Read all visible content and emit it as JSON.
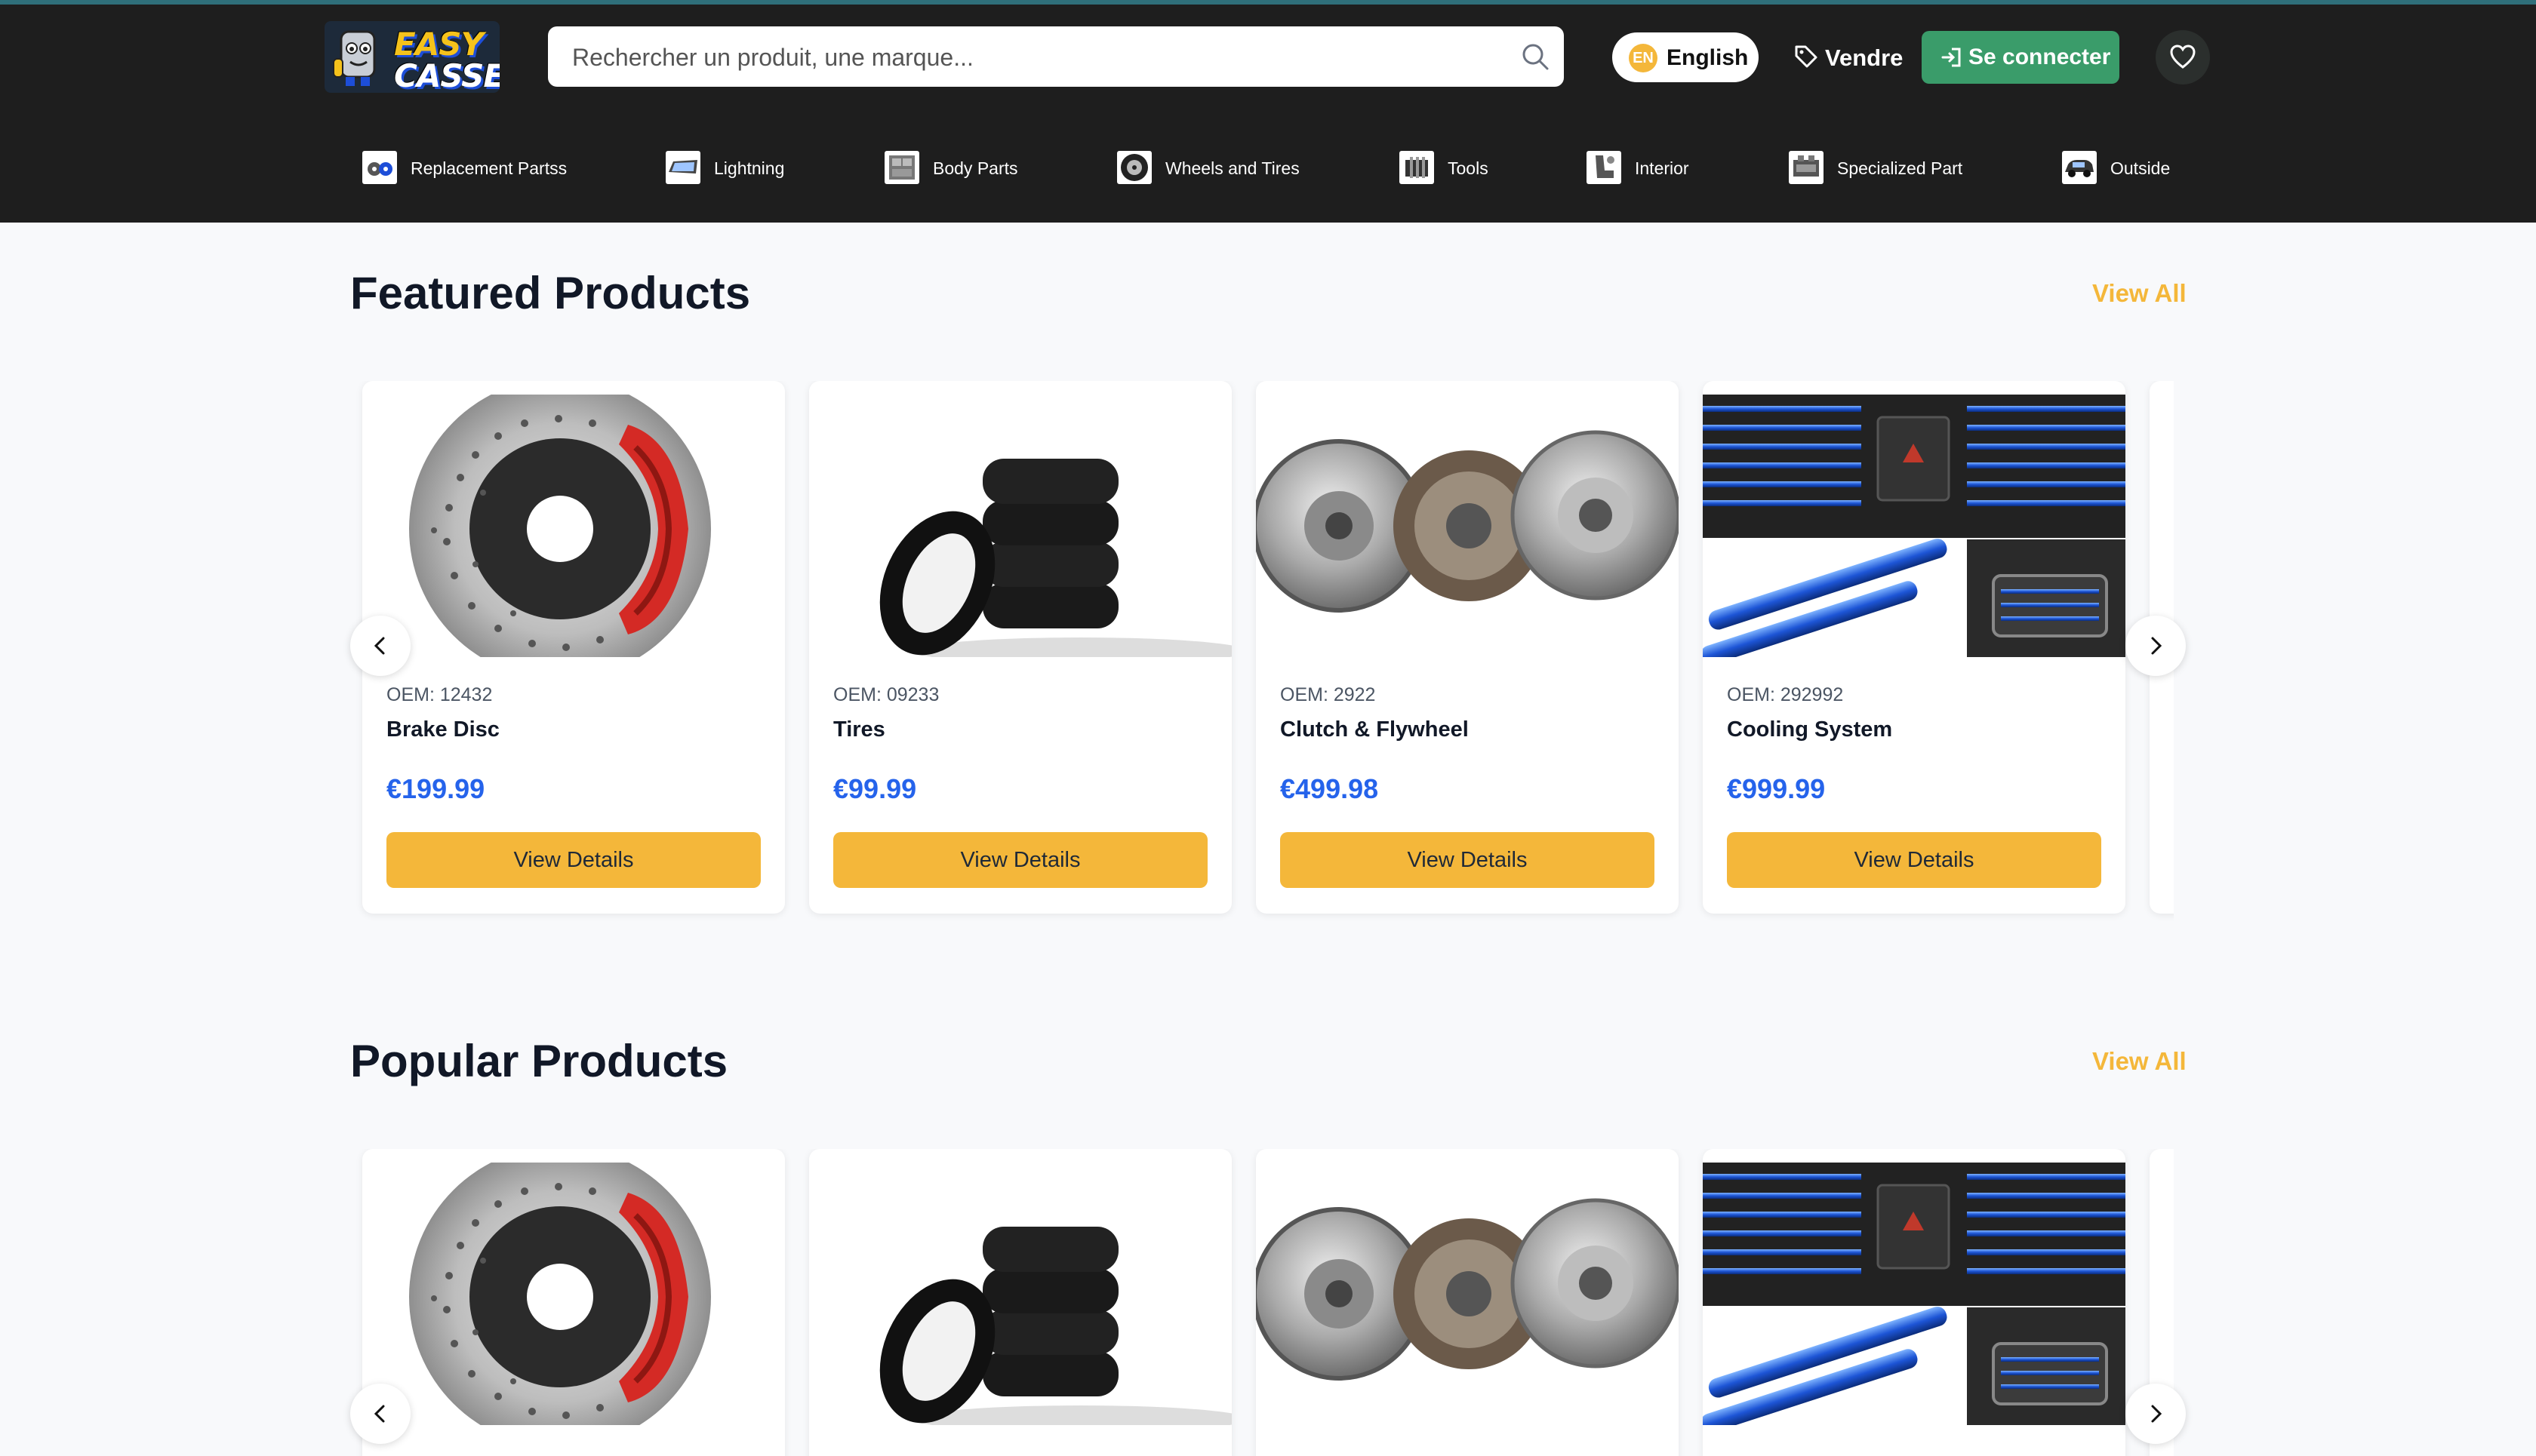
{
  "brand": {
    "logo_line1": "EASY",
    "logo_line2": "CASSE"
  },
  "search": {
    "placeholder": "Rechercher un produit, une marque..."
  },
  "header": {
    "language_code": "EN",
    "language_label": "English",
    "sell_label": "Vendre",
    "login_label": "Se connecter"
  },
  "categories": [
    {
      "label": "Replacement Partss",
      "icon": "brake-parts-icon"
    },
    {
      "label": "Lightning",
      "icon": "headlight-icon"
    },
    {
      "label": "Body Parts",
      "icon": "car-body-icon"
    },
    {
      "label": "Wheels and Tires",
      "icon": "wheel-icon"
    },
    {
      "label": "Tools",
      "icon": "tools-icon"
    },
    {
      "label": "Interior",
      "icon": "seat-icon"
    },
    {
      "label": "Specialized Part",
      "icon": "engine-icon"
    },
    {
      "label": "Outside",
      "icon": "car-exterior-icon"
    }
  ],
  "featured": {
    "title": "Featured Products",
    "view_all": "View All",
    "products": [
      {
        "oem": "OEM: 12432",
        "name": "Brake Disc",
        "price": "€199.99",
        "button": "View Details",
        "image": "brake-disc"
      },
      {
        "oem": "OEM: 09233",
        "name": "Tires",
        "price": "€99.99",
        "button": "View Details",
        "image": "tires"
      },
      {
        "oem": "OEM: 2922",
        "name": "Clutch & Flywheel",
        "price": "€499.98",
        "button": "View Details",
        "image": "clutch-flywheel"
      },
      {
        "oem": "OEM: 292992",
        "name": "Cooling System",
        "price": "€999.99",
        "button": "View Details",
        "image": "cooling-system"
      }
    ]
  },
  "popular": {
    "title": "Popular Products",
    "view_all": "View All"
  },
  "colors": {
    "header_bg": "#1e1e1e",
    "accent_yellow": "#f4b73a",
    "login_green": "#3a9c6a",
    "price_blue": "#2563eb"
  }
}
